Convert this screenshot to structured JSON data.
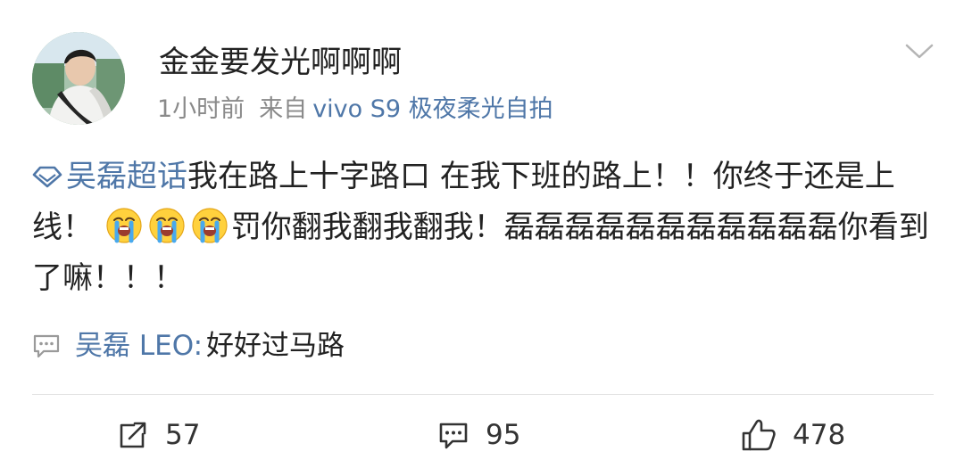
{
  "post": {
    "author": "金金要发光啊啊啊",
    "time": "1小时前",
    "from_label": "来自",
    "device": "vivo S9 极夜柔光自拍",
    "topic": "吴磊超话",
    "text_before_emoji": "我在路上十字路口 在我下班的路上！！你终于还是上线！",
    "emoji": "loudly-crying-face",
    "text_after_emoji": "罚你翻我翻我翻我！磊磊磊磊磊磊磊磊磊磊磊你看到了嘛！！！"
  },
  "featured_comment": {
    "author": "吴磊 LEO",
    "separator": ":",
    "text": "好好过马路"
  },
  "actions": {
    "share_count": "57",
    "comment_count": "95",
    "like_count": "478"
  },
  "colors": {
    "link_blue": "#4f77a8",
    "text": "#222222",
    "muted": "#8a8a8a",
    "divider": "#e2e2e2"
  }
}
